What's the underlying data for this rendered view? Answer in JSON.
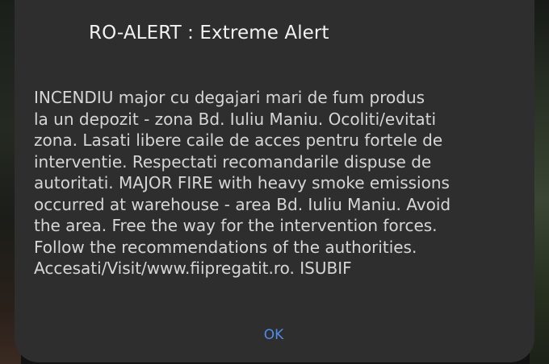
{
  "dialog": {
    "title": "RO-ALERT : Extreme Alert",
    "message_lines": [
      "INCENDIU major cu degajari mari de fum produs",
      "la un depozit - zona Bd. Iuliu Maniu. Ocoliti/evitati",
      "zona. Lasati libere caile de acces pentru fortele de",
      "interventie. Respectati recomandarile dispuse de",
      "autoritati. MAJOR FIRE with heavy smoke emissions",
      "occurred at warehouse - area Bd. Iuliu Maniu. Avoid",
      "the area. Free the way for the intervention forces.",
      "Follow the recommendations of the authorities.",
      "Accesati/Visit/www.fiipregatit.ro. ISUBIF"
    ],
    "ok_label": "OK"
  },
  "colors": {
    "dialog_background": "#2e2e2e",
    "title_text": "#f2f2f2",
    "message_text": "#d6d6d6",
    "accent": "#4f8de9"
  }
}
